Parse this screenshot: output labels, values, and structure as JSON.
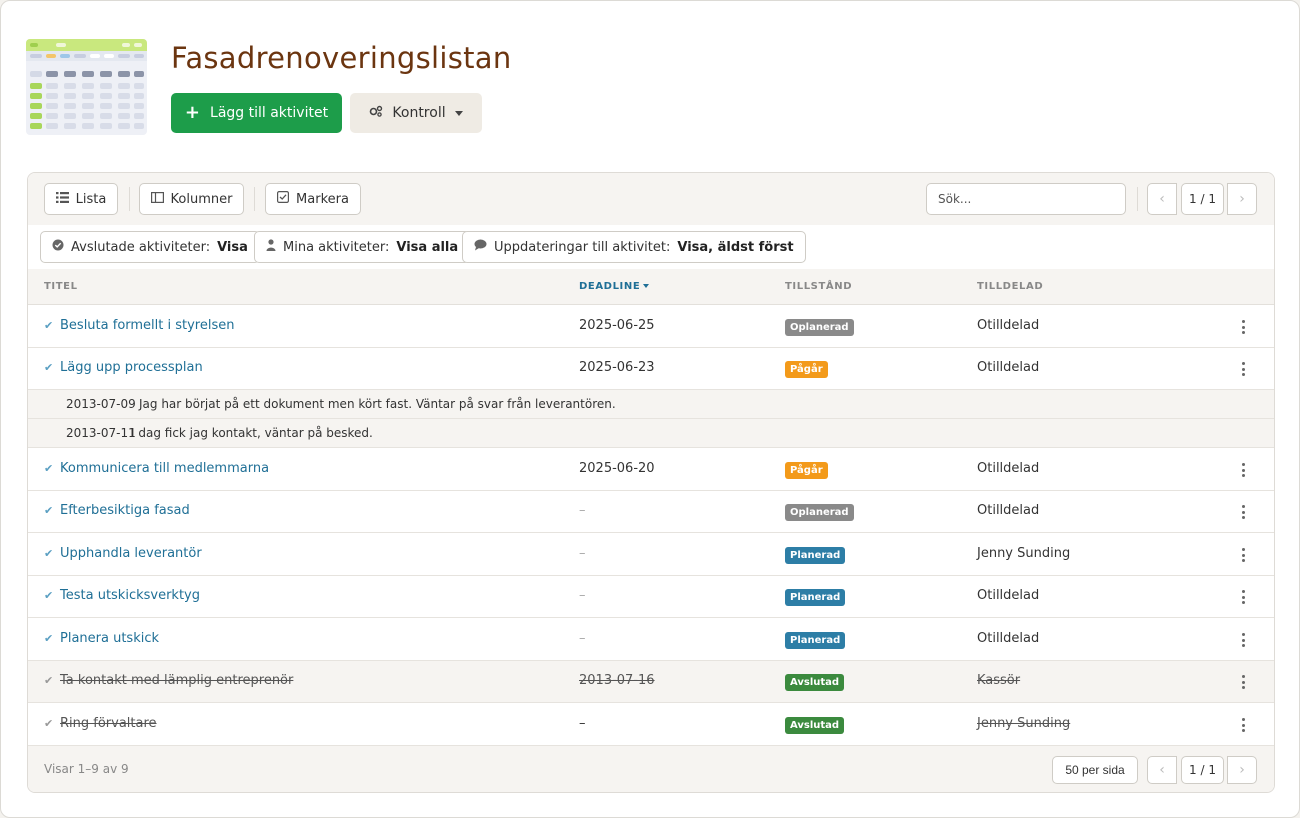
{
  "header": {
    "title": "Fasadrenoveringslistan",
    "add_button": "Lägg till aktivitet",
    "control_button": "Kontroll"
  },
  "toolbar": {
    "list_label": "Lista",
    "columns_label": "Kolumner",
    "select_label": "Markera",
    "search_placeholder": "Sök...",
    "pagination": "1 / 1"
  },
  "filters": [
    {
      "label": "Avslutade aktiviteter:",
      "value": "Visa"
    },
    {
      "label": "Mina aktiviteter:",
      "value": "Visa alla"
    },
    {
      "label": "Uppdateringar till aktivitet:",
      "value": "Visa, äldst först"
    }
  ],
  "columns": {
    "title": "TITEL",
    "deadline": "DEADLINE",
    "status": "TILLSTÅND",
    "assignee": "TILLDELAD"
  },
  "status_colors": {
    "Oplanerad": "#8a8a8a",
    "Pågår": "#f39a1a",
    "Planerad": "#2d7ea6",
    "Avslutad": "#3b8a3e"
  },
  "rows": [
    {
      "title": "Besluta formellt i styrelsen",
      "deadline": "2025-06-25",
      "status": "Oplanerad",
      "assignee": "Otilldelad",
      "done": false
    },
    {
      "title": "Lägg upp processplan",
      "deadline": "2025-06-23",
      "status": "Pågår",
      "assignee": "Otilldelad",
      "done": false
    },
    {
      "title": "Kommunicera till medlemmarna",
      "deadline": "2025-06-20",
      "status": "Pågår",
      "assignee": "Otilldelad",
      "done": false
    },
    {
      "title": "Efterbesiktiga fasad",
      "deadline": "–",
      "status": "Oplanerad",
      "assignee": "Otilldelad",
      "done": false
    },
    {
      "title": "Upphandla leverantör",
      "deadline": "–",
      "status": "Planerad",
      "assignee": "Jenny Sunding",
      "done": false
    },
    {
      "title": "Testa utskicksverktyg",
      "deadline": "–",
      "status": "Planerad",
      "assignee": "Otilldelad",
      "done": false
    },
    {
      "title": "Planera utskick",
      "deadline": "–",
      "status": "Planerad",
      "assignee": "Otilldelad",
      "done": false
    },
    {
      "title": "Ta kontakt med lämplig entreprenör",
      "deadline": "2013-07-16",
      "status": "Avslutad",
      "assignee": "Kassör",
      "done": true
    },
    {
      "title": "Ring förvaltare",
      "deadline": "–",
      "status": "Avslutad",
      "assignee": "Jenny Sunding",
      "done": true
    }
  ],
  "notes": [
    {
      "date": "2013-07-09",
      "text": "Jag har börjat på ett dokument men kört fast. Väntar på svar från leverantören."
    },
    {
      "date": "2013-07-11",
      "text": "I dag fick jag kontakt, väntar på besked."
    }
  ],
  "footer": {
    "count": "Visar 1–9 av 9",
    "per_page": "50 per sida",
    "pagination": "1 / 1"
  }
}
